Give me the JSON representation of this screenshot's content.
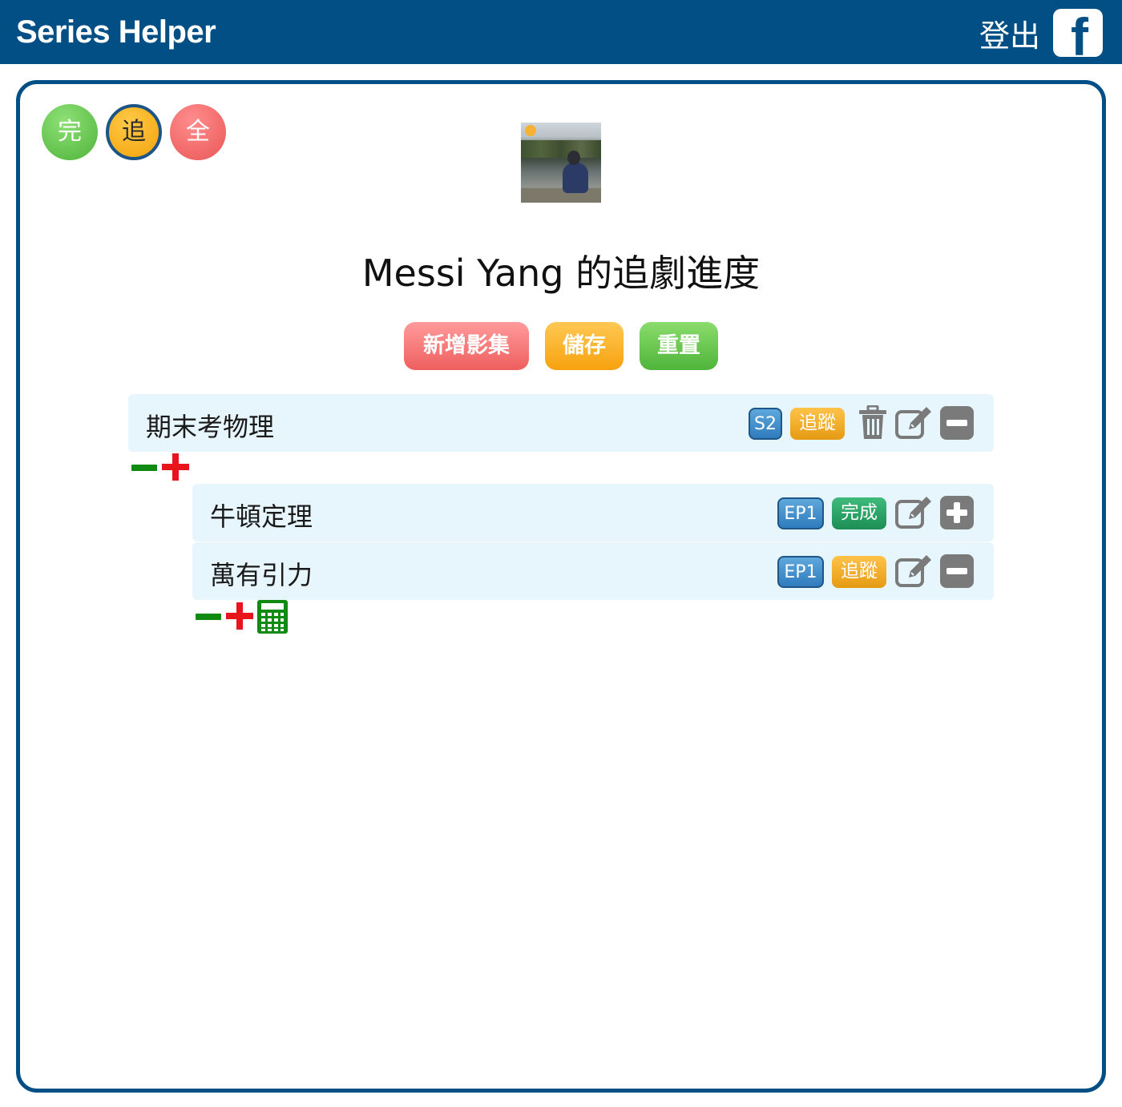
{
  "header": {
    "brand": "Series Helper",
    "logout_label": "登出",
    "facebook_icon": "facebook-icon"
  },
  "filters": {
    "done": "完",
    "tracking": "追",
    "all": "全"
  },
  "page_title": "Messi Yang 的追劇進度",
  "actions": {
    "add_series": "新增影集",
    "save": "儲存",
    "reset": "重置"
  },
  "series": [
    {
      "title": "期末考物理",
      "season_badge": "S2",
      "status_badge": "追蹤",
      "icons": [
        "trash-icon",
        "edit-icon",
        "collapse-minus-icon"
      ],
      "controls": [
        "minus-icon",
        "plus-icon"
      ],
      "episodes": [
        {
          "title": "牛頓定理",
          "episode_badge": "EP1",
          "status_badge": "完成",
          "status_color": "#1c8e55",
          "icons": [
            "edit-icon",
            "expand-plus-icon"
          ]
        },
        {
          "title": "萬有引力",
          "episode_badge": "EP1",
          "status_badge": "追蹤",
          "status_color": "#e59a12",
          "icons": [
            "edit-icon",
            "collapse-minus-icon"
          ]
        }
      ],
      "episode_controls": [
        "minus-icon",
        "plus-icon",
        "calculator-icon"
      ]
    }
  ],
  "colors": {
    "header": "#014f84",
    "row_bg": "#e7f5fd",
    "minus": "#118a12",
    "plus": "#e8141b"
  }
}
